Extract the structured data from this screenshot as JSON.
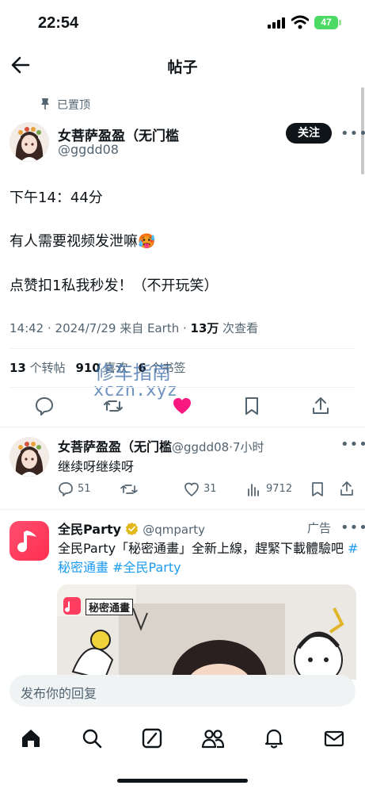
{
  "status_bar": {
    "time": "22:54",
    "battery": "47"
  },
  "header": {
    "title": "帖子"
  },
  "post": {
    "pinned_label": "已置顶",
    "author_name": "女菩萨盈盈（无门槛",
    "author_handle": "@ggdd08",
    "follow_label": "关注",
    "lines": [
      "下午14：44分",
      "有人需要视频发泄嘛🥵",
      "点赞扣1私我秒发！（不开玩笑）"
    ],
    "meta_prefix": "14:42 · 2024/7/29 来自 Earth · ",
    "views_count": "13万",
    "views_label": " 次查看",
    "reposts_count": "13",
    "reposts_label": " 个转帖",
    "likes_count": "910",
    "likes_label": " 喜欢",
    "bookmarks_count": "6",
    "bookmarks_label": " 个书签"
  },
  "watermark": {
    "line1": "修车指南",
    "line2": "xczn.xyz"
  },
  "reply": {
    "author_name": "女菩萨盈盈（无门槛",
    "author_handle": "@ggdd08",
    "time": "·7小时",
    "text": "继续呀继续呀",
    "replies": "51",
    "likes": "31",
    "views": "9712"
  },
  "ad": {
    "name": "全民Party",
    "handle": "@qmparty",
    "label": "广告",
    "text": "全民Party「秘密通畫」全新上線，趕緊下載體驗吧 ",
    "hashtag1": "#秘密通畫",
    "hashtag2": "#全民Party",
    "image_caption": "秘密通畫"
  },
  "composer": {
    "placeholder": "发布你的回复"
  },
  "tabs": [
    "home-icon",
    "search-icon",
    "grok-icon",
    "communities-icon",
    "notifications-icon",
    "messages-icon"
  ],
  "colors": {
    "accent": "#1d9bf0",
    "like": "#f91880",
    "verified": "#e2b719",
    "text": "#0f1419",
    "muted": "#536471"
  }
}
